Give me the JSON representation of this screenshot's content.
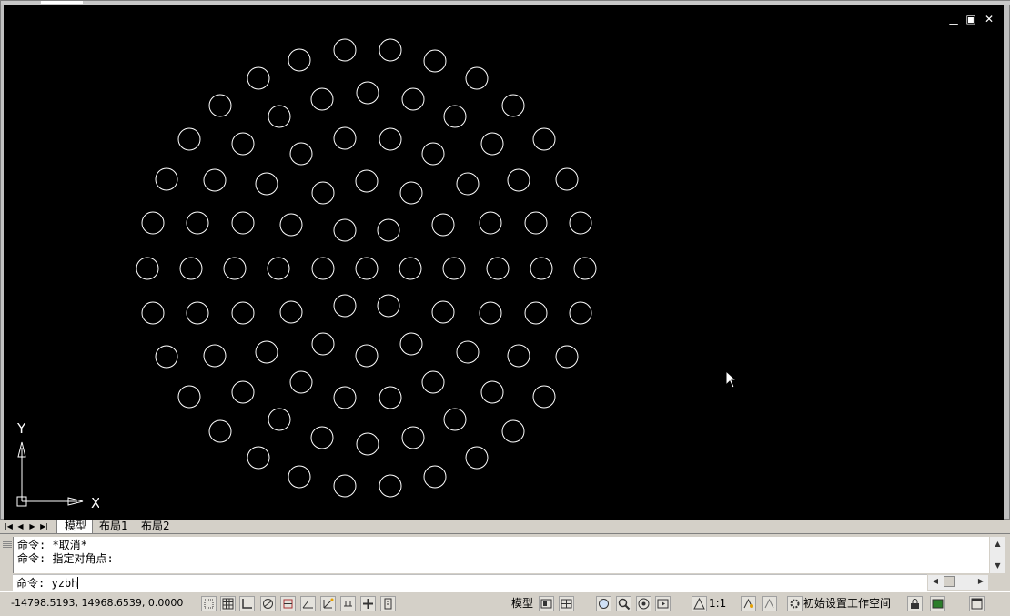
{
  "window": {
    "minimize_glyph": "▁",
    "restore_glyph": "▣",
    "close_glyph": "✕"
  },
  "ucs": {
    "y_label": "Y",
    "x_label": "X"
  },
  "canvas": {
    "background": "#000000",
    "stroke": "#ffffff",
    "content": "hexagonal pattern of small circles"
  },
  "layout_tabs": {
    "nav": [
      "|◀",
      "◀",
      "▶",
      "▶|"
    ],
    "tabs": [
      {
        "label": "模型",
        "active": true
      },
      {
        "label": "布局1",
        "active": false
      },
      {
        "label": "布局2",
        "active": false
      }
    ]
  },
  "command": {
    "history": [
      "命令: *取消*",
      "命令: 指定对角点:"
    ],
    "prompt": "命令:",
    "input_value": "yzbh"
  },
  "status": {
    "coordinates": "-14798.5193, 14968.6539, 0.0000",
    "model_label": "模型",
    "scale_label": "1:1",
    "workspace_label": "初始设置工作空间"
  },
  "icons": [
    "snap-icon",
    "grid-icon",
    "ortho-icon",
    "polar-icon",
    "osnap-icon",
    "otrack-icon",
    "ducs-icon",
    "dyn-icon",
    "lwt-icon",
    "qp-icon",
    "layout-icon",
    "viewports-icon",
    "pan-icon",
    "zoom-icon",
    "steering-wheel-icon",
    "showmotion-icon",
    "annotation-scale-icon",
    "annotation-visibility-icon",
    "auto-scale-icon",
    "workspace-icon",
    "lock-icon",
    "hardware-accel-icon",
    "clean-screen-icon"
  ]
}
